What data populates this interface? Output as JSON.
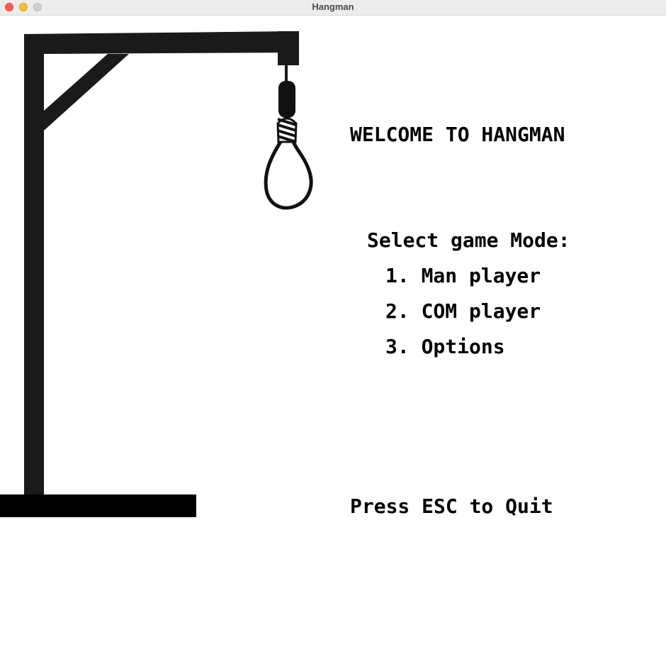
{
  "window": {
    "title": "Hangman"
  },
  "menu": {
    "welcome": "WELCOME TO HANGMAN",
    "select_label": "Select game Mode:",
    "options": [
      "1. Man player",
      "2. COM player",
      "3. Options"
    ],
    "quit_hint": "Press ESC to Quit"
  },
  "colors": {
    "gallows": "#1a1a1a",
    "text": "#000000",
    "background": "#ffffff"
  }
}
